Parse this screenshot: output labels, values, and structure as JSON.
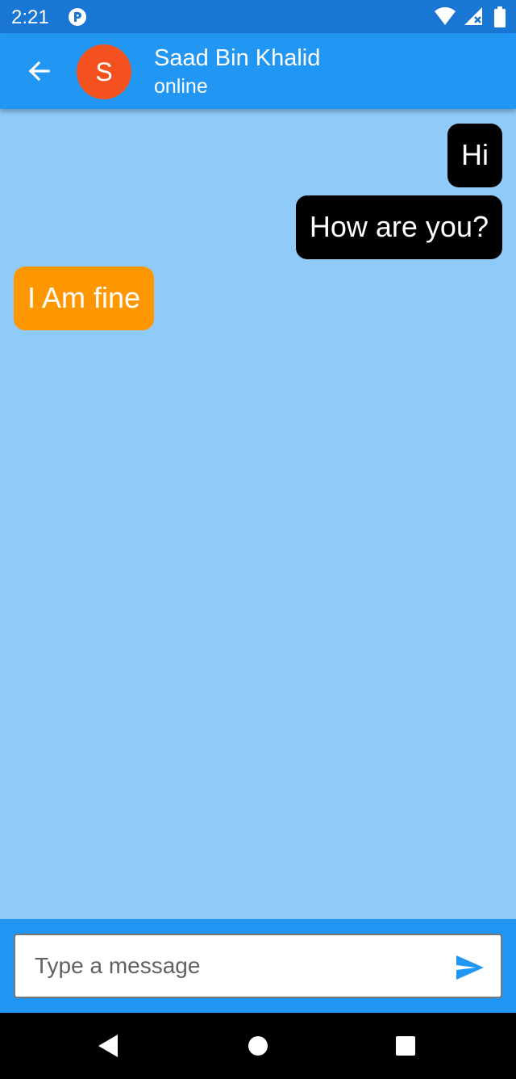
{
  "status_bar": {
    "time": "2:21",
    "icons": [
      "app-notification-icon",
      "wifi-icon",
      "signal-icon",
      "battery-icon"
    ]
  },
  "app_bar": {
    "contact_name": "Saad Bin Khalid",
    "contact_status": "online",
    "avatar_initial": "S",
    "icons": [
      "back-arrow-icon"
    ]
  },
  "chat": {
    "messages": [
      {
        "text": "Hi",
        "direction": "outgoing"
      },
      {
        "text": "How are you?",
        "direction": "outgoing"
      },
      {
        "text": "I Am fine",
        "direction": "incoming"
      }
    ]
  },
  "composer": {
    "placeholder": "Type a message",
    "value": "",
    "icons": [
      "send-icon"
    ]
  },
  "nav_bar": {
    "icons": [
      "back-triangle-icon",
      "home-circle-icon",
      "recents-square-icon"
    ]
  },
  "colors": {
    "status_bar": "#1976d2",
    "app_bar": "#2196f3",
    "chat_background": "#90caf9",
    "outgoing_bubble": "#000000",
    "incoming_bubble": "#ff9800",
    "avatar": "#f4511e",
    "send_icon": "#2196f3"
  }
}
